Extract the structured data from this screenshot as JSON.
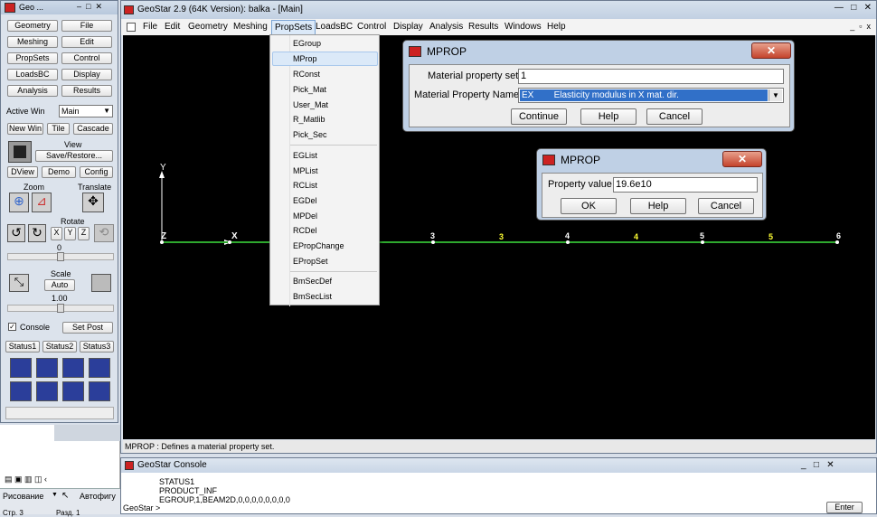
{
  "left_panel": {
    "title": "Geo ...",
    "rows": [
      [
        "Geometry",
        "File"
      ],
      [
        "Meshing",
        "Edit"
      ],
      [
        "PropSets",
        "Control"
      ],
      [
        "LoadsBC",
        "Display"
      ],
      [
        "Analysis",
        "Results"
      ]
    ],
    "active_win_label": "Active Win",
    "active_win_value": "Main",
    "new_win": "New Win",
    "tile": "Tile",
    "cascade": "Cascade",
    "view_label": "View",
    "save_restore": "Save/Restore...",
    "dview": "DView",
    "demo": "Demo",
    "config": "Config",
    "zoom_label": "Zoom",
    "translate_label": "Translate",
    "rotate_label": "Rotate",
    "rotate_x": "X",
    "rotate_y": "Y",
    "rotate_z": "Z",
    "rotate_value": "0",
    "scale_label": "Scale",
    "scale_auto": "Auto",
    "scale_value": "1.00",
    "console_label": "Console",
    "set_post": "Set Post",
    "status_tabs": [
      "Status1",
      "Status2",
      "Status3"
    ]
  },
  "main_window": {
    "title": "GeoStar 2.9 (64K Version): balka - [Main]",
    "menu": [
      "File",
      "Edit",
      "Geometry",
      "Meshing",
      "PropSets",
      "LoadsBC",
      "Control",
      "Display",
      "Analysis",
      "Results",
      "Windows",
      "Help"
    ],
    "status": "MPROP : Defines a material property set."
  },
  "propsets_menu": {
    "group1": [
      "EGroup",
      "MProp",
      "RConst",
      "Pick_Mat",
      "User_Mat",
      "R_Matlib",
      "Pick_Sec"
    ],
    "group2": [
      "EGList",
      "MPList",
      "RCList",
      "EGDel",
      "MPDel",
      "RCDel",
      "EPropChange",
      "EPropSet"
    ],
    "group3": [
      "BmSecDef",
      "BmSecList"
    ],
    "highlighted": "MProp"
  },
  "canvas": {
    "axis_y": "Y",
    "axis_x": "X",
    "axis_z": "Z",
    "node_labels": [
      "3",
      "4",
      "5",
      "6"
    ],
    "element_labels": [
      "3",
      "4",
      "5"
    ]
  },
  "dialog_mprop1": {
    "title": "MPROP",
    "set_label": "Material property set",
    "set_value": "1",
    "name_label": "Material Property Name",
    "name_value": "EX        Elasticity modulus in X mat. dir.",
    "continue": "Continue",
    "help": "Help",
    "cancel": "Cancel"
  },
  "dialog_mprop2": {
    "title": "MPROP",
    "value_label": "Property value",
    "value": "19.6e10",
    "ok": "OK",
    "help": "Help",
    "cancel": "Cancel"
  },
  "console": {
    "title": "GeoStar Console",
    "lines": [
      "STATUS1",
      "PRODUCT_INF",
      "EGROUP,1,BEAM2D,0,0,0,0,0,0,0,0"
    ],
    "prompt": "GeoStar >",
    "enter": "Enter"
  },
  "taskbar": {
    "draw_menu": "Рисование",
    "autoshapes": "Автофигу",
    "page_info": "Стр. 3",
    "section_info": "Разд. 1"
  },
  "colors": {
    "accent_blue": "#3170c8",
    "canvas_bg": "#000000",
    "beam_green": "#2ea82e",
    "element_label_yellow": "#ffff33"
  }
}
